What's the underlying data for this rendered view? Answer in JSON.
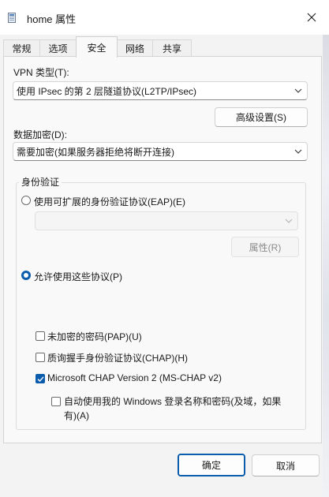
{
  "window": {
    "title": "home 属性"
  },
  "tabs": [
    {
      "label": "常规"
    },
    {
      "label": "选项"
    },
    {
      "label": "安全"
    },
    {
      "label": "网络"
    },
    {
      "label": "共享"
    }
  ],
  "security": {
    "vpn_type_label": "VPN 类型(T):",
    "vpn_type_value": "使用 IPsec 的第 2 层隧道协议(L2TP/IPsec)",
    "advanced_button": "高级设置(S)",
    "encryption_label": "数据加密(D):",
    "encryption_value": "需要加密(如果服务器拒绝将断开连接)",
    "auth_group_label": "身份验证",
    "eap_option": "使用可扩展的身份验证协议(EAP)(E)",
    "eap_select_value": "",
    "properties_button": "属性(R)",
    "allow_protocols_option": "允许使用这些协议(P)",
    "protocols": [
      {
        "label": "未加密的密码(PAP)(U)",
        "checked": false
      },
      {
        "label": "质询握手身份验证协议(CHAP)(H)",
        "checked": false
      },
      {
        "label": "Microsoft CHAP Version 2 (MS-CHAP v2)",
        "checked": true
      }
    ],
    "auto_logon_line1": "自动使用我的 Windows 登录名称和密码(及域，如果",
    "auto_logon_line2": "有)(A)"
  },
  "footer": {
    "ok_button": "确定",
    "cancel_button": "取消"
  },
  "colors": {
    "accent": "#0b5cad"
  }
}
